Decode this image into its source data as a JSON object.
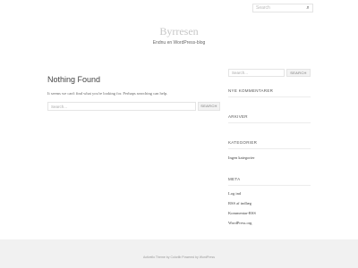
{
  "header": {
    "search_placeholder": "Search",
    "search_icon": "search-icon",
    "site_title": "Byrresen",
    "site_description": "Endnu en WordPress-blog"
  },
  "main": {
    "title": "Nothing Found",
    "message": "It seems we can't find what you're looking for. Perhaps searching can help.",
    "search_placeholder": "Search...",
    "search_button": "SEARCH"
  },
  "sidebar": {
    "search_placeholder": "Search...",
    "search_button": "SEARCH",
    "widgets": {
      "recent_comments": "NYE KOMMENTARER",
      "archives": "ARKIVER",
      "categories": "KATEGORIER",
      "categories_items": [
        "Ingen kategorier"
      ],
      "meta": "META",
      "meta_items": [
        "Log ind",
        "RSS af indlæg",
        "Kommentar-RSS",
        "WordPress.org"
      ]
    }
  },
  "footer": {
    "text": "Activello Theme by Colorlib Powered by WordPress"
  }
}
